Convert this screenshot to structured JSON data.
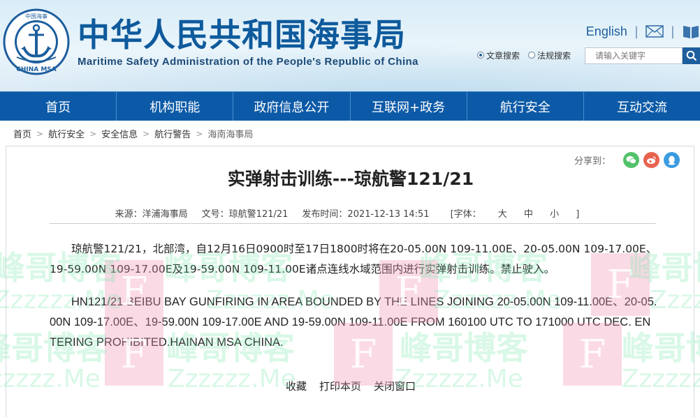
{
  "header": {
    "title": "中华人民共和国海事局",
    "subtitle": "Maritime Safety Administration of the People's Republic of China",
    "logo_text": "CHINA MSA",
    "logo_top_text": "中国海事",
    "english_label": "English",
    "search": {
      "option_article": "文章搜索",
      "option_law": "法规搜索",
      "placeholder": "请输入关键字"
    }
  },
  "nav": {
    "items": [
      "首页",
      "机构职能",
      "政府信息公开",
      "互联网+政务",
      "航行安全",
      "互动交流"
    ]
  },
  "breadcrumb": [
    "首页",
    "航行安全",
    "安全信息",
    "航行警告",
    "海南海事局"
  ],
  "share": {
    "label": "分享到："
  },
  "article": {
    "title": "实弹射击训练---琼航警121/21",
    "source": "来源：洋浦海事局",
    "doc_no": "文号：琼航警121/21",
    "published": "发布时间：2021-12-13 14:51",
    "font_label": "[字体：",
    "font_large": "大",
    "font_medium": "中",
    "font_small": "小",
    "font_close": "]",
    "paragraph_cn": "琼航警121/21，北部湾，自12月16日0900时至17日1800时将在20-05.00N 109-11.00E、20-05.00N 109-17.00E、19-59.00N 109-17.00E及19-59.00N 109-11.00E诸点连线水域范围内进行实弹射击训练。禁止驶入。",
    "paragraph_en": "HN121/21 BEIBU BAY GUNFIRING IN AREA BOUNDED BY THE LINES JOINING 20-05.00N 109-11.00E、20-05.00N 109-17.00E、19-59.00N 109-17.00E AND 19-59.00N 109-11.00E FROM 160100 UTC TO 171000 UTC DEC. ENTERING PROHIBITED.HAINAN MSA CHINA."
  },
  "actions": {
    "favorite": "收藏",
    "print": "打印本页",
    "close": "关闭窗口"
  },
  "watermark": {
    "text_cn": "峰哥博客",
    "text_en": "Zzzzzz.Me",
    "letter": "F"
  },
  "colors": {
    "brand_blue": "#0c5aa7",
    "title_blue": "#0e5a9c",
    "wechat_green": "#52c26b",
    "weibo_red": "#e8624f",
    "qq_blue": "#3a9be0"
  }
}
